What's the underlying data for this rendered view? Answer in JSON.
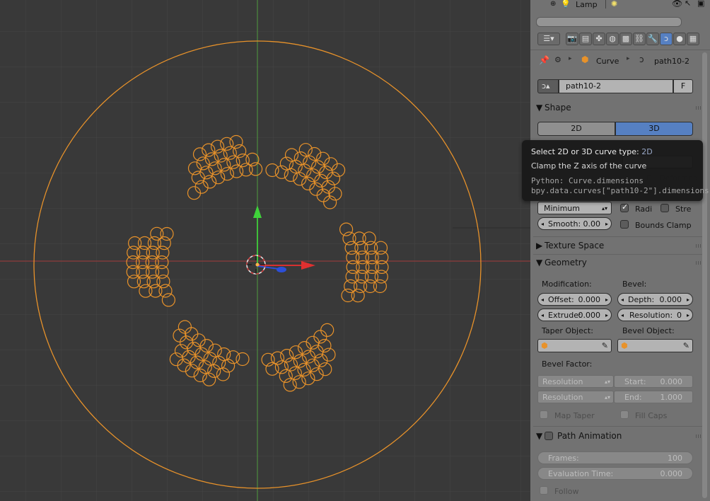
{
  "outliner": {
    "lamp_label": "Lamp"
  },
  "breadcrumb": {
    "object": "Curve",
    "data": "path10-2"
  },
  "datablock": {
    "name": "path10-2",
    "fake_user": "F"
  },
  "shape": {
    "header": "Shape",
    "mode_2d": "2D",
    "mode_3d": "3D",
    "active_mode": "3D",
    "twist_method": "Minimum",
    "radius_label": "Radi",
    "radius_checked": true,
    "stretch_label": "Stre",
    "stretch_checked": false,
    "smooth_label": "Smooth:",
    "smooth_value": "0.00",
    "bounds_clamp_label": "Bounds Clamp",
    "bounds_clamp_checked": false
  },
  "tooltip": {
    "title": "Select 2D or 3D curve type:",
    "title_value": "2D",
    "description": "Clamp the Z axis of the curve",
    "python_line1": "Python: Curve.dimensions",
    "python_line2": "bpy.data.curves[\"path10-2\"].dimensions"
  },
  "texture_space": {
    "header": "Texture Space"
  },
  "geometry": {
    "header": "Geometry",
    "modification_label": "Modification:",
    "bevel_label": "Bevel:",
    "offset_label": "Offset:",
    "offset_value": "0.000",
    "depth_label": "Depth:",
    "depth_value": "0.000",
    "extrude_label": "Extrude:",
    "extrude_value": "0.000",
    "resolution_label": "Resolution:",
    "resolution_value": "0",
    "taper_object_label": "Taper Object:",
    "bevel_object_label": "Bevel Object:",
    "bevel_factor_label": "Bevel Factor:",
    "factor_mapping_start": "Resolution",
    "factor_mapping_end": "Resolution",
    "start_label": "Start:",
    "start_value": "0.000",
    "end_label": "End:",
    "end_value": "1.000",
    "map_taper_label": "Map Taper",
    "fill_caps_label": "Fill Caps"
  },
  "path_animation": {
    "header": "Path Animation",
    "frames_label": "Frames:",
    "frames_value": "100",
    "eval_time_label": "Evaluation Time:",
    "eval_time_value": "0.000",
    "follow_label": "Follow"
  },
  "colors": {
    "curve": "#e8922a",
    "x_axis": "#c23a3a",
    "y_axis": "#59a44a",
    "viewport_bg": "#393939",
    "panel_bg": "#727272",
    "active_blue": "#5680c2"
  }
}
